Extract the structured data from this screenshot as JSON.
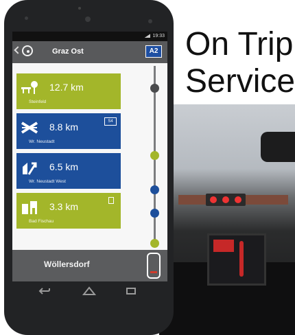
{
  "headline": {
    "line1": "On Trip",
    "line2": "Service"
  },
  "status_bar": {
    "time": "19:33"
  },
  "header": {
    "title": "Graz Ost",
    "highway_badge": "A2"
  },
  "items": [
    {
      "distance": "12.7 km",
      "name": "Steinfeld",
      "color": "#a3b62a",
      "icon": "rest-area-icon"
    },
    {
      "distance": "8.8 km",
      "name": "Wr. Neustadt",
      "badge": "S4",
      "color": "#1d4f9b",
      "icon": "interchange-icon"
    },
    {
      "distance": "6.5 km",
      "name": "Wr. Neustadt West",
      "color": "#1d4f9b",
      "icon": "exit-icon"
    },
    {
      "distance": "3.3 km",
      "name": "Bad Fischau",
      "color": "#a3b62a",
      "icon": "service-station-icon"
    }
  ],
  "destination": {
    "label": "Wöllersdorf"
  },
  "colors": {
    "green": "#a3b62a",
    "blue": "#1d4f9b",
    "dark_gray": "#58595b",
    "red_marker": "#d13b2b"
  }
}
